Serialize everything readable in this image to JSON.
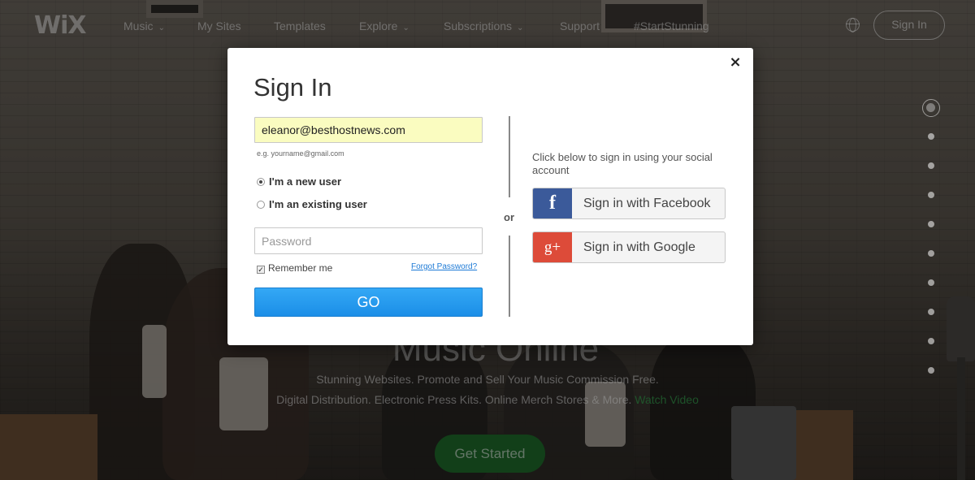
{
  "nav": {
    "logo": "WiX",
    "items": [
      {
        "label": "Music",
        "has_dropdown": true
      },
      {
        "label": "My Sites",
        "has_dropdown": false
      },
      {
        "label": "Templates",
        "has_dropdown": false
      },
      {
        "label": "Explore",
        "has_dropdown": true
      },
      {
        "label": "Subscriptions",
        "has_dropdown": true
      },
      {
        "label": "Support",
        "has_dropdown": false
      },
      {
        "label": "#StartStunning",
        "has_dropdown": false
      }
    ],
    "chevron": "⌄",
    "globe_icon": "globe-icon",
    "sign_in_label": "Sign In"
  },
  "hero": {
    "heading": "Music Online",
    "line1": "Stunning Websites. Promote and Sell Your Music Commission Free.",
    "line2": "Digital Distribution. Electronic Press Kits. Online Merch Stores & More.",
    "watch_video": "Watch Video",
    "get_started": "Get Started"
  },
  "page_dots": {
    "count": 10,
    "active_index": 0
  },
  "modal": {
    "title": "Sign In",
    "close_glyph": "×",
    "email_value": "eleanor@besthostnews.com",
    "email_hint": "e.g. yourname@gmail.com",
    "new_user_label": "I'm a new user",
    "existing_user_label": "I'm an existing user",
    "selected_user_type": "new",
    "password_placeholder": "Password",
    "remember_label": "Remember me",
    "remember_checked": true,
    "forgot_password": "Forgot Password?",
    "go_label": "GO",
    "or_label": "or",
    "social_text": "Click below to sign in using your social account",
    "facebook": {
      "icon_glyph": "f",
      "label": "Sign in with Facebook",
      "color": "#3b5a9a"
    },
    "google": {
      "icon_glyph": "g+",
      "label": "Sign in with Google",
      "color": "#dd4b39"
    }
  },
  "colors": {
    "accent_blue": "#1b8ee7",
    "email_fill": "#fafcc0",
    "watch_green": "#35a34f",
    "get_started_green": "#1f6a2b"
  }
}
